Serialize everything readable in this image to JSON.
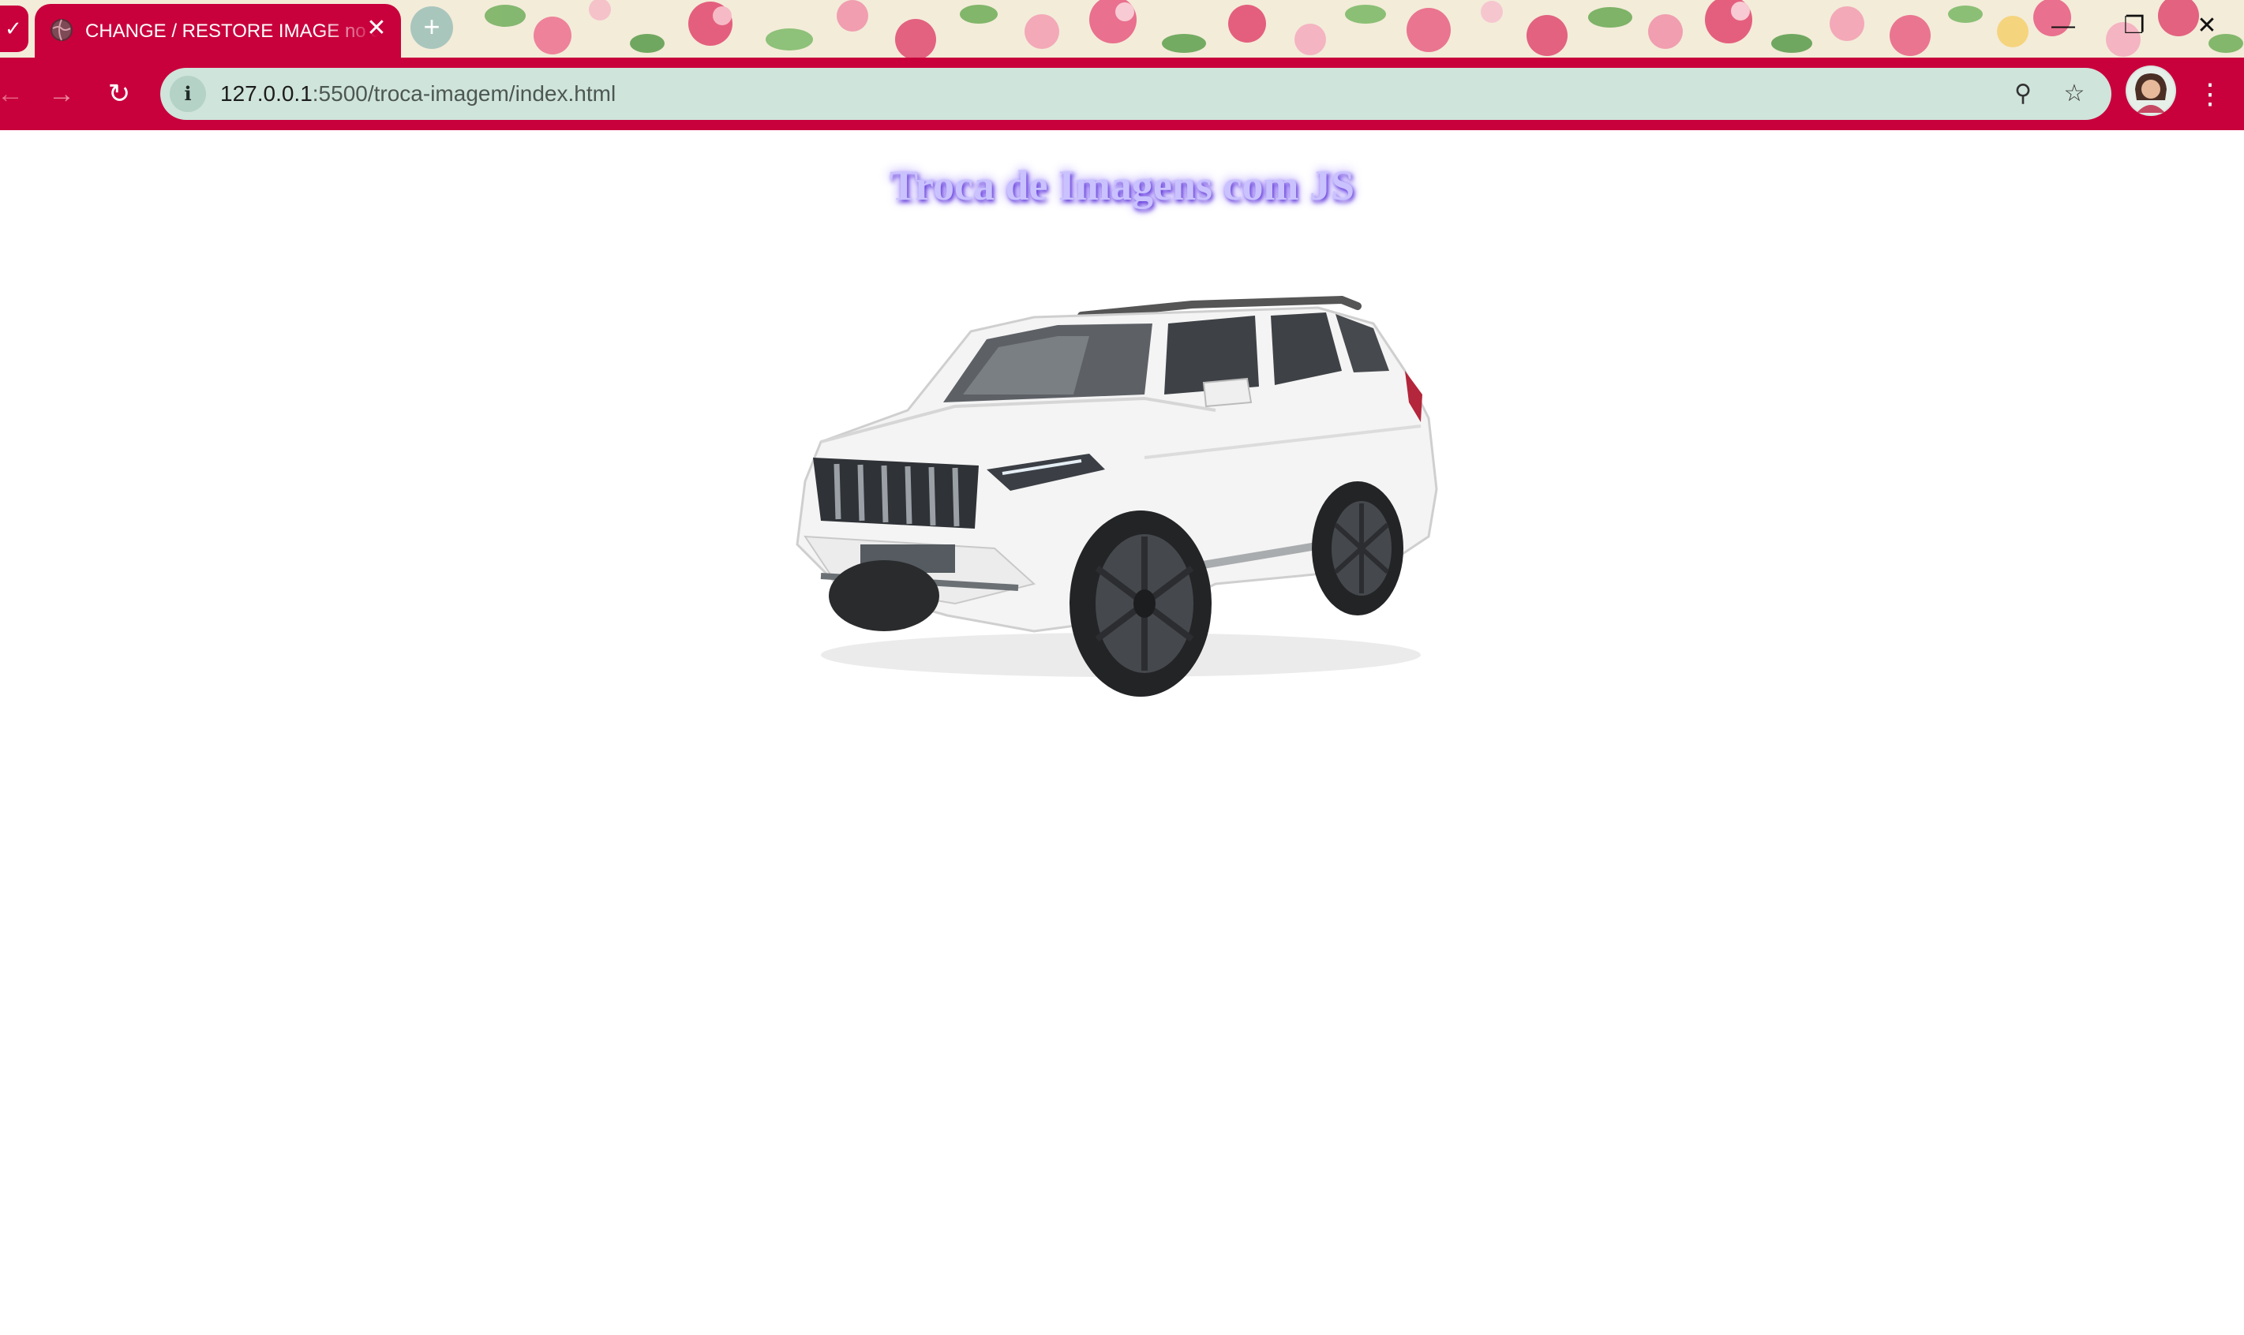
{
  "browser": {
    "tab": {
      "title": "CHANGE / RESTORE IMAGE no JS",
      "close_glyph": "✕",
      "favicon": "globe-icon"
    },
    "tab_search_glyph": "✓",
    "new_tab_glyph": "+",
    "window_controls": {
      "minimize": "—",
      "restore": "❐",
      "close": "✕"
    },
    "nav": {
      "back": "←",
      "forward": "→",
      "reload": "↻"
    },
    "address_bar": {
      "host": "127.0.0.1",
      "path": ":5500/troca-imagem/index.html",
      "info_glyph": "i"
    },
    "zoom_glyph": "⚲",
    "bookmark_glyph": "☆",
    "menu_glyph": "⋮",
    "colors": {
      "theme": "#c8003c",
      "omnibox": "#cfe4db",
      "titlebar": "#f3ecd9"
    }
  },
  "page": {
    "title": "Troca de Imagens com JS",
    "title_color": "#c9c2ff",
    "title_glow": "#5a2fd6",
    "image": {
      "subject": "white SUV",
      "icon": "suv-image"
    }
  }
}
